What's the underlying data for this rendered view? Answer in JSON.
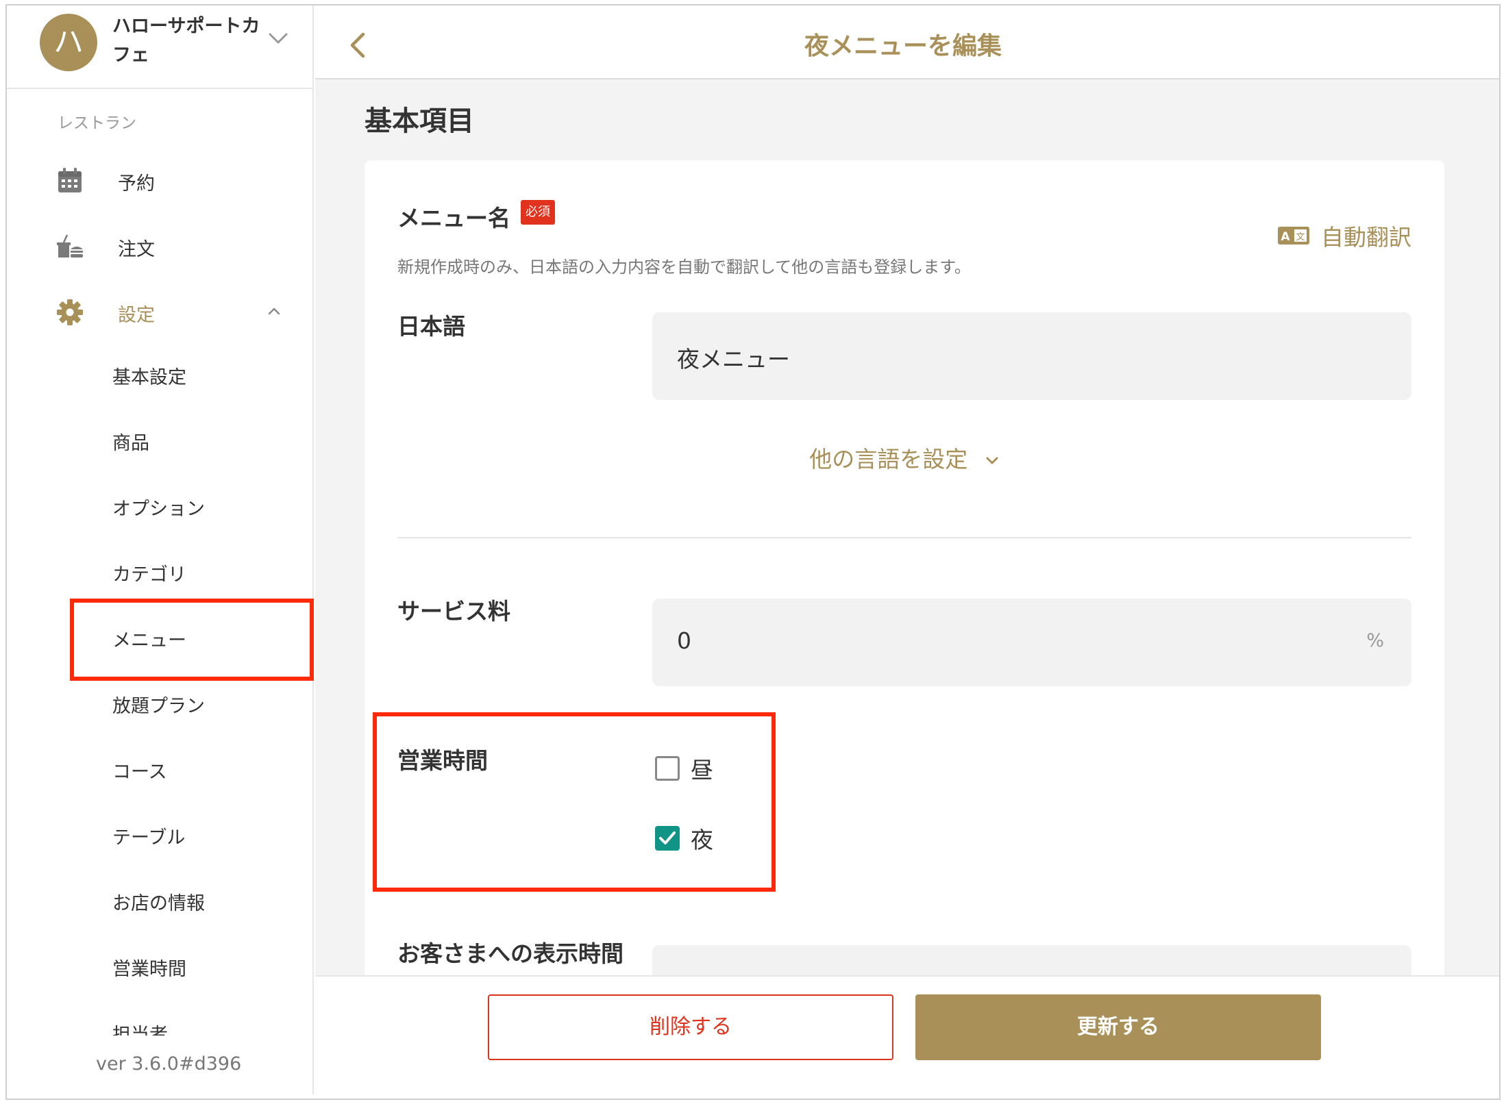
{
  "store": {
    "avatar_initial": "ハ",
    "name": "ハローサポートカフェ"
  },
  "sidebar": {
    "section_label": "レストラン",
    "nav": [
      {
        "label": "予約",
        "icon": "calendar-icon"
      },
      {
        "label": "注文",
        "icon": "order-icon"
      },
      {
        "label": "設定",
        "icon": "gear-icon",
        "expanded": true
      }
    ],
    "settings_items": [
      "基本設定",
      "商品",
      "オプション",
      "カテゴリ",
      "メニュー",
      "放題プラン",
      "コース",
      "テーブル",
      "お店の情報",
      "営業時間",
      "担当者"
    ],
    "active_item": "メニュー",
    "version": "ver 3.6.0#d396"
  },
  "header": {
    "title": "夜メニューを編集",
    "back_icon": "chevron-left-icon"
  },
  "section_title": "基本項目",
  "menu_name": {
    "label": "メニュー名",
    "required_badge": "必須",
    "auto_translate_label": "自動翻訳",
    "hint": "新規作成時のみ、日本語の入力内容を自動で翻訳して他の言語も登録します。",
    "japanese_label": "日本語",
    "japanese_value": "夜メニュー",
    "other_languages_link": "他の言語を設定"
  },
  "service_fee": {
    "label": "サービス料",
    "value": "0",
    "suffix": "%"
  },
  "business_hours": {
    "label": "営業時間",
    "options": [
      {
        "label": "昼",
        "checked": false
      },
      {
        "label": "夜",
        "checked": true
      }
    ]
  },
  "display_time": {
    "label": "お客さまへの表示時間"
  },
  "buttons": {
    "delete": "削除する",
    "update": "更新する"
  },
  "colors": {
    "accent": "#a89058",
    "danger": "#e0321c",
    "checkbox": "#109485",
    "highlight": "#ff2a0a"
  }
}
